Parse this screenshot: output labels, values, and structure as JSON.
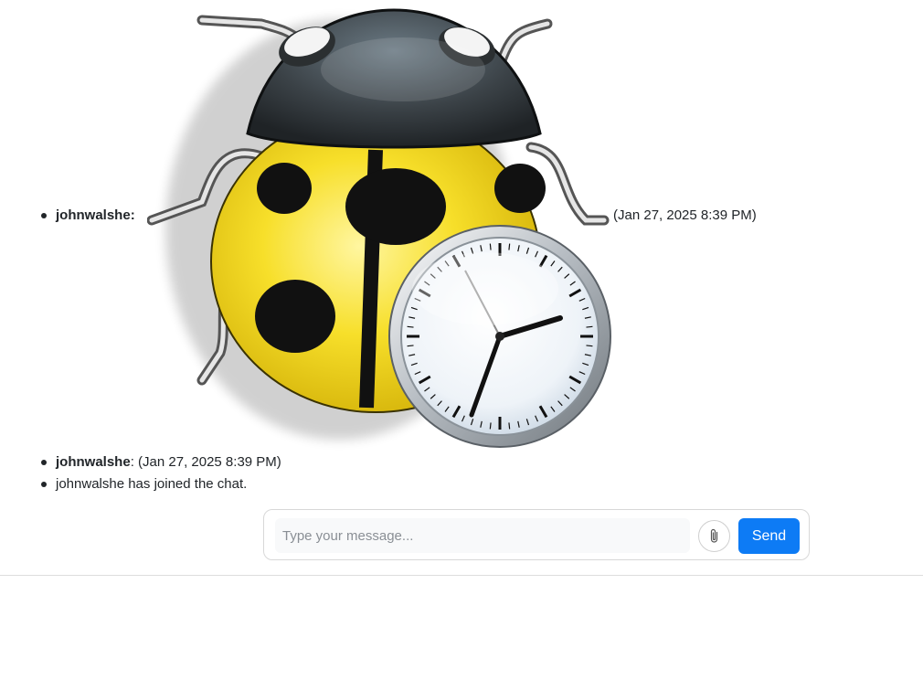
{
  "messages": [
    {
      "user": "johnwalshe",
      "separator": ":",
      "timestamp": "(Jan 27, 2025 8:39 PM)",
      "attachment_icon": "ladybug-clock-icon"
    },
    {
      "user": "johnwalshe",
      "separator": ":",
      "timestamp": "(Jan 27, 2025 8:39 PM)"
    },
    {
      "system_text": "johnwalshe has joined the chat."
    }
  ],
  "composer": {
    "placeholder": "Type your message...",
    "attach_icon": "paperclip-icon",
    "send_label": "Send"
  },
  "colors": {
    "accent": "#0d7bf5",
    "ladybug_yellow": "#f7df2a",
    "ladybug_head": "#3b4247"
  }
}
